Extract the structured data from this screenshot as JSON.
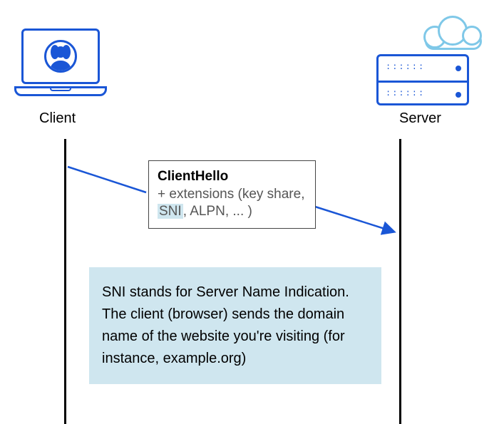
{
  "client": {
    "label": "Client"
  },
  "server": {
    "label": "Server"
  },
  "message": {
    "title": "ClientHello",
    "extensions_prefix": "+ extensions (key share, ",
    "sni_term": "SNI",
    "extensions_suffix": ", ALPN, ... )"
  },
  "explanation": {
    "text": "SNI stands for Server Name Indication. The client (browser) sends the domain name of the website you're visiting (for instance, example.org)"
  },
  "colors": {
    "accent": "#1a56d6",
    "cloud": "#7fc8e8",
    "highlight": "#cfe6ef"
  }
}
